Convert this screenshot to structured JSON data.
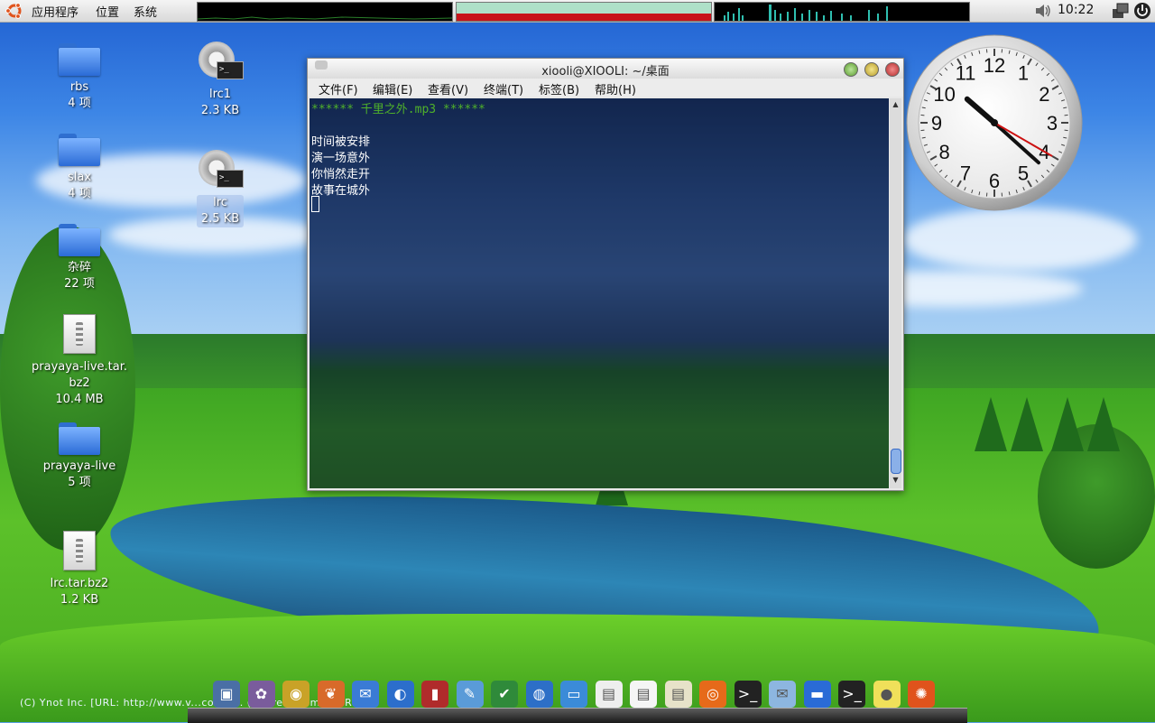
{
  "top_panel": {
    "menus": [
      "应用程序",
      "位置",
      "系统"
    ],
    "time": "10:22"
  },
  "desktop_icons": [
    {
      "name": "rbs",
      "info": "4 项",
      "type": "folder"
    },
    {
      "name": "slax",
      "info": "4 项",
      "type": "folder"
    },
    {
      "name": "杂碎",
      "info": "22 项",
      "type": "folder"
    },
    {
      "name_line1": "prayaya-live.tar.",
      "name_line2": "bz2",
      "info": "10.4 MB",
      "type": "archive"
    },
    {
      "name": "prayaya-live",
      "info": "5 项",
      "type": "folder"
    },
    {
      "name": "lrc.tar.bz2",
      "info": "1.2 KB",
      "type": "archive"
    },
    {
      "name": "lrc1",
      "info": "2.3 KB",
      "type": "script"
    },
    {
      "name": "lrc",
      "info": "2.5 KB",
      "type": "script"
    }
  ],
  "terminal": {
    "title": "xiooli@XIOOLI: ~/桌面",
    "menu": [
      "文件(F)",
      "编辑(E)",
      "查看(V)",
      "终端(T)",
      "标签(B)",
      "帮助(H)"
    ],
    "lines": [
      "****** 千里之外.mp3 ******",
      "",
      "时间被安排",
      "演一场意外",
      "你悄然走开",
      "故事在城外"
    ]
  },
  "clock": {
    "numbers": [
      "12",
      "1",
      "2",
      "3",
      "4",
      "5",
      "6",
      "7",
      "8",
      "9",
      "10",
      "11"
    ],
    "time_display": "10:22"
  },
  "wallpaper": {
    "copyright": "(C) Ynot Inc. [URL: http://www.v...co...] ... (C) Freak ...me ... RU..."
  },
  "dock": {
    "items": [
      "vmware-icon",
      "gimp-icon",
      "eye-icon",
      "fox-icon",
      "doc-icon",
      "gnome-icon",
      "red-book-icon",
      "pen-icon",
      "vim-icon",
      "globe-icon",
      "monitor-icon",
      "pdf-icon",
      "text-icon",
      "font-icon",
      "firefox-icon",
      "terminal-icon",
      "mail-icon",
      "folder-icon",
      "terminal2-icon",
      "pill-icon",
      "ubuntu-icon"
    ]
  },
  "colors": {
    "panel_bg": "#e6e6e6",
    "terminal_green_text": "#4fb12a",
    "terminal_white_text": "#ffffff",
    "mem_bar": "#c8141a",
    "mem_bg": "#aee0c8",
    "selection": "#aac3eb",
    "clock_second_hand": "#cc1111"
  }
}
